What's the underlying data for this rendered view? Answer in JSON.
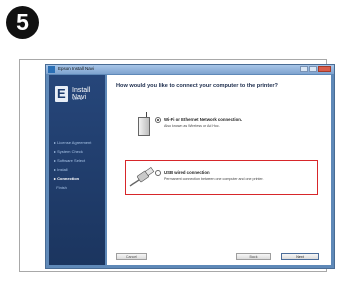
{
  "step_number": "5",
  "window": {
    "title": "Epson Install Navi"
  },
  "sidebar": {
    "brand_title": "Install Navi",
    "brand_version": "Ver. 6",
    "items": [
      {
        "label": "License Agreement",
        "state": "done"
      },
      {
        "label": "System Check",
        "state": "done"
      },
      {
        "label": "Software Select",
        "state": "done"
      },
      {
        "label": "Install",
        "state": "done"
      },
      {
        "label": "Connection",
        "state": "current"
      },
      {
        "label": "Finish",
        "state": "pending"
      }
    ]
  },
  "main": {
    "question": "How would you like to connect your computer to the printer?",
    "options": [
      {
        "title": "Wi-Fi or Ethernet Network connection.",
        "description": "Also known as Wireless or Ad Hoc.",
        "selected": true,
        "icon": "router-icon"
      },
      {
        "title": "USB wired connection",
        "description": "Permanent connection between one computer and one printer.",
        "selected": false,
        "icon": "usb-cable-icon"
      }
    ]
  },
  "footer": {
    "cancel_label": "Cancel",
    "back_label": "Back",
    "next_label": "Next"
  },
  "colors": {
    "highlight": "#d7262a",
    "sidebar": "#1d3c6e"
  }
}
